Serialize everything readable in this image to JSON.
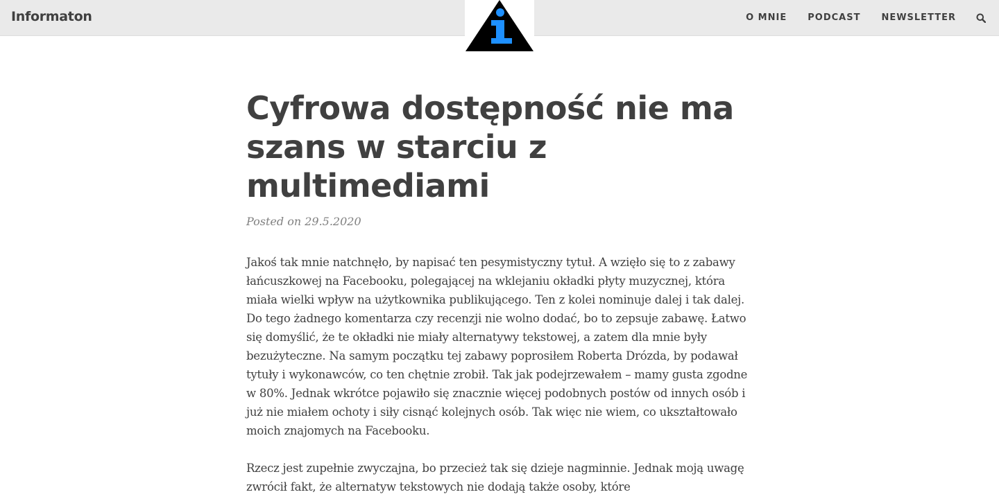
{
  "site": {
    "brand": "Informaton"
  },
  "nav": {
    "items": [
      {
        "label": "O MNIE"
      },
      {
        "label": "PODCAST"
      },
      {
        "label": "NEWSLETTER"
      }
    ],
    "search_icon": "search-icon"
  },
  "logo": {
    "icon": "information-triangle-logo",
    "colors": {
      "triangle": "#000000",
      "glyph": "#1e90ff"
    }
  },
  "post": {
    "title": "Cyfrowa dostępność nie ma szans w starciu z multimediami",
    "meta": "Posted on 29.5.2020",
    "paragraphs": [
      "Jakoś tak mnie natchnęło, by napisać ten pesymistyczny tytuł. A wzięło się to z zabawy łańcuszkowej na Facebooku, polegającej na wklejaniu okładki płyty muzycznej, która miała wielki wpływ na użytkownika publikującego. Ten z kolei nominuje dalej i tak dalej. Do tego żadnego komentarza czy recenzji nie wolno dodać, bo to zepsuje zabawę. Łatwo się domyślić, że te okładki nie miały alternatywy tekstowej, a zatem dla mnie były bezużyteczne. Na samym początku tej zabawy poprosiłem Roberta Drózda, by podawał tytuły i wykonawców, co ten chętnie zrobił. Tak jak podejrzewałem – mamy gusta zgodne w 80%. Jednak wkrótce pojawiło się znacznie więcej podobnych postów od innych osób i już nie miałem ochoty i siły cisnąć kolejnych osób. Tak więc nie wiem, co ukształtowało moich znajomych na Facebooku.",
      "Rzecz jest zupełnie zwyczajna, bo przecież tak się dzieje nagminnie. Jednak moją uwagę zwrócił fakt, że alternatyw tekstowych nie dodają także osoby, które"
    ]
  },
  "colors": {
    "navbar_bg": "#eaeaea",
    "text": "#404040",
    "meta": "#808080",
    "accent": "#1e90ff"
  }
}
